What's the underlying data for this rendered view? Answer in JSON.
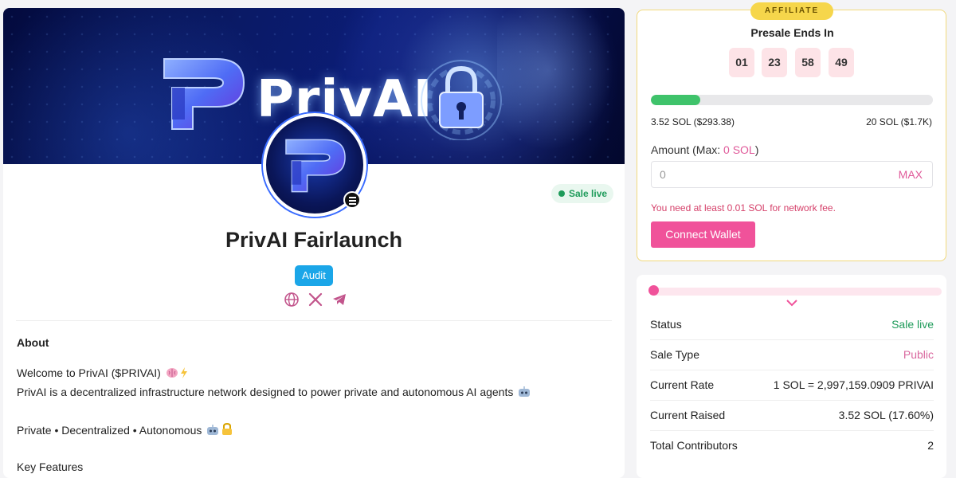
{
  "banner": {
    "title": "PrivAI"
  },
  "project": {
    "name": "PrivAI Fairlaunch",
    "status_badge": "Sale live",
    "audit_label": "Audit",
    "socials": [
      "globe-icon",
      "x-icon",
      "telegram-icon"
    ]
  },
  "about": {
    "heading": "About",
    "line1": "Welcome to PrivAI ($PRIVAI)",
    "line2": "PrivAI is a decentralized infrastructure network designed to power private and autonomous AI agents",
    "line3": "Private • Decentralized • Autonomous",
    "line4": "Key Features"
  },
  "presale": {
    "affiliate_label": "AFFILIATE",
    "title": "Presale Ends In",
    "countdown": [
      "01",
      "23",
      "58",
      "49"
    ],
    "progress_fraction": 0.176,
    "raised": "3.52 SOL ($293.38)",
    "cap": "20 SOL ($1.7K)",
    "amount_label": "Amount (Max: ",
    "amount_max": "0 SOL",
    "amount_label_end": ")",
    "amount_value": "0",
    "max_button": "MAX",
    "fee_warning": "You need at least 0.01 SOL for network fee.",
    "connect_label": "Connect Wallet"
  },
  "details": {
    "rows": [
      {
        "key": "Status",
        "value": "Sale live",
        "color": "#1e9b5a"
      },
      {
        "key": "Sale Type",
        "value": "Public",
        "color": "#d9679e"
      },
      {
        "key": "Current Rate",
        "value": "1 SOL = 2,997,159.0909 PRIVAI",
        "color": "#222222"
      },
      {
        "key": "Current Raised",
        "value": "3.52 SOL (17.60%)",
        "color": "#222222"
      },
      {
        "key": "Total Contributors",
        "value": "2",
        "color": "#222222"
      }
    ]
  },
  "colors": {
    "accent": "#f0529a",
    "success": "#3fc36b",
    "audit": "#1ba6e8",
    "affiliate": "#f6d64b"
  }
}
